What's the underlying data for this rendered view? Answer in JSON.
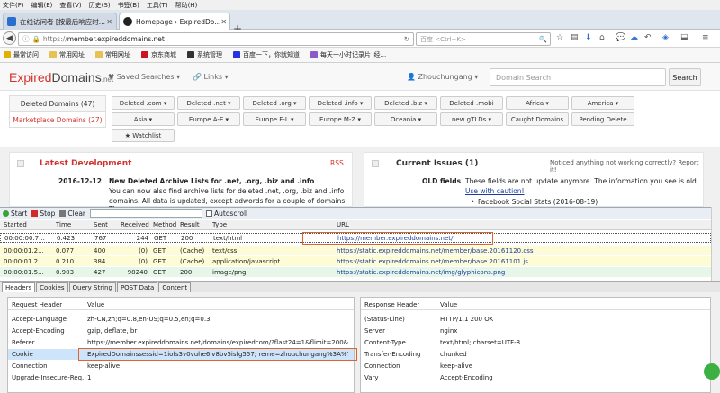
{
  "menu": [
    "文件(F)",
    "编辑(E)",
    "查看(V)",
    "历史(S)",
    "书签(B)",
    "工具(T)",
    "帮助(H)"
  ],
  "tabs": [
    {
      "label": "在线访问者 [按最后响应时..."
    },
    {
      "label": "Homepage › ExpiredDo..."
    }
  ],
  "url": {
    "protocol": "https://",
    "host": "member.expireddomains.net"
  },
  "search_placeholder": "百度 <Ctrl+K>",
  "bookmarks": [
    "最常访问",
    "常用网址",
    "常用网址",
    "京东商城",
    "系统管理",
    "百度一下，你就知道",
    "每天一小时记录片_经..."
  ],
  "site": {
    "logo_a": "Expired",
    "logo_b": "Domains",
    "logo_c": ".net",
    "saved_searches": "♥ Saved Searches ▾",
    "links": "🔗 Links ▾",
    "user": "👤 Zhouchungang ▾",
    "search_placeholder": "Domain Search",
    "search_btn": "Search"
  },
  "side": {
    "deleted": "Deleted Domains (47)",
    "marketplace": "Marketplace Domains (27)"
  },
  "filters": [
    "Deleted .com ▾",
    "Deleted .net ▾",
    "Deleted .org ▾",
    "Deleted .info ▾",
    "Deleted .biz ▾",
    "Deleted .mobi",
    "Africa ▾",
    "America ▾",
    "Asia ▾",
    "Europe A-E ▾",
    "Europe F-L ▾",
    "Europe M-Z ▾",
    "Oceania ▾",
    "new gTLDs ▾",
    "Caught Domains",
    "Pending Delete",
    "★ Watchlist"
  ],
  "latest": {
    "title": "Latest Development",
    "rss": "RSS",
    "date": "2016-12-12",
    "headline": "New Deleted Archive Lists for .net, .org, .biz and .info",
    "line1": "You can now also find archive lists for deleted .net, .org, .biz and .info",
    "line2": "domains. All data is updated, except adwords for a couple of domains. The"
  },
  "issues": {
    "title": "Current Issues (1)",
    "notice": "Noticed anything not working correctly? Report it!",
    "label": "OLD fields",
    "text1": "These fields are not update anymore. The information you see is old.",
    "link": "Use with caution!",
    "bullet": "Facebook Social Stats (2016-08-19)"
  },
  "hw_toolbar": {
    "start": "Start",
    "stop": "Stop",
    "clear": "Clear",
    "autoscroll": "Autoscroll"
  },
  "grid": {
    "headers": [
      "Started",
      "Time",
      "Sent",
      "Received",
      "Method",
      "Result",
      "Type",
      "URL"
    ],
    "rows": [
      [
        "00:00:00.7...",
        "0.423",
        "767",
        "244",
        "GET",
        "200",
        "text/html",
        "https://member.expireddomains.net/"
      ],
      [
        "00:00:01.2...",
        "0.077",
        "400",
        "(0)",
        "GET",
        "(Cache)",
        "text/css",
        "https://static.expireddomains.net/member/base.20161120.css"
      ],
      [
        "00:00:01.2...",
        "0.210",
        "384",
        "(0)",
        "GET",
        "(Cache)",
        "application/javascript",
        "https://static.expireddomains.net/member/base.20161101.js"
      ],
      [
        "00:00:01.5...",
        "0.903",
        "427",
        "98240",
        "GET",
        "200",
        "image/png",
        "https://static.expireddomains.net/img/glyphicons.png"
      ]
    ]
  },
  "lower_tabs": [
    "Headers",
    "Cookies",
    "Query String",
    "POST Data",
    "Content"
  ],
  "req": {
    "h1": "Request Header",
    "h2": "Value",
    "rows": [
      [
        "Accept-Language",
        "zh-CN,zh;q=0.8,en-US;q=0.5,en;q=0.3"
      ],
      [
        "Accept-Encoding",
        "gzip, deflate, br"
      ],
      [
        "Referer",
        "https://member.expireddomains.net/domains/expiredcom/?flast24=1&flimit=200&f..."
      ],
      [
        "Cookie",
        "ExpiredDomainssessid=1iofs3v0vuhe6lv8bv5isfg557; reme=zhouchungang%3A%7C..."
      ],
      [
        "Connection",
        "keep-alive"
      ],
      [
        "Upgrade-Insecure-Req...",
        "1"
      ]
    ]
  },
  "resp": {
    "h1": "Response Header",
    "h2": "Value",
    "rows": [
      [
        "(Status-Line)",
        "HTTP/1.1 200 OK"
      ],
      [
        "Server",
        "nginx"
      ],
      [
        "Content-Type",
        "text/html; charset=UTF-8"
      ],
      [
        "Transfer-Encoding",
        "chunked"
      ],
      [
        "Connection",
        "keep-alive"
      ],
      [
        "Vary",
        "Accept-Encoding"
      ]
    ]
  },
  "colors": {
    "brand_red": "#d2322d",
    "link_blue": "#1a3d9c",
    "highlight": "#e0632a"
  }
}
